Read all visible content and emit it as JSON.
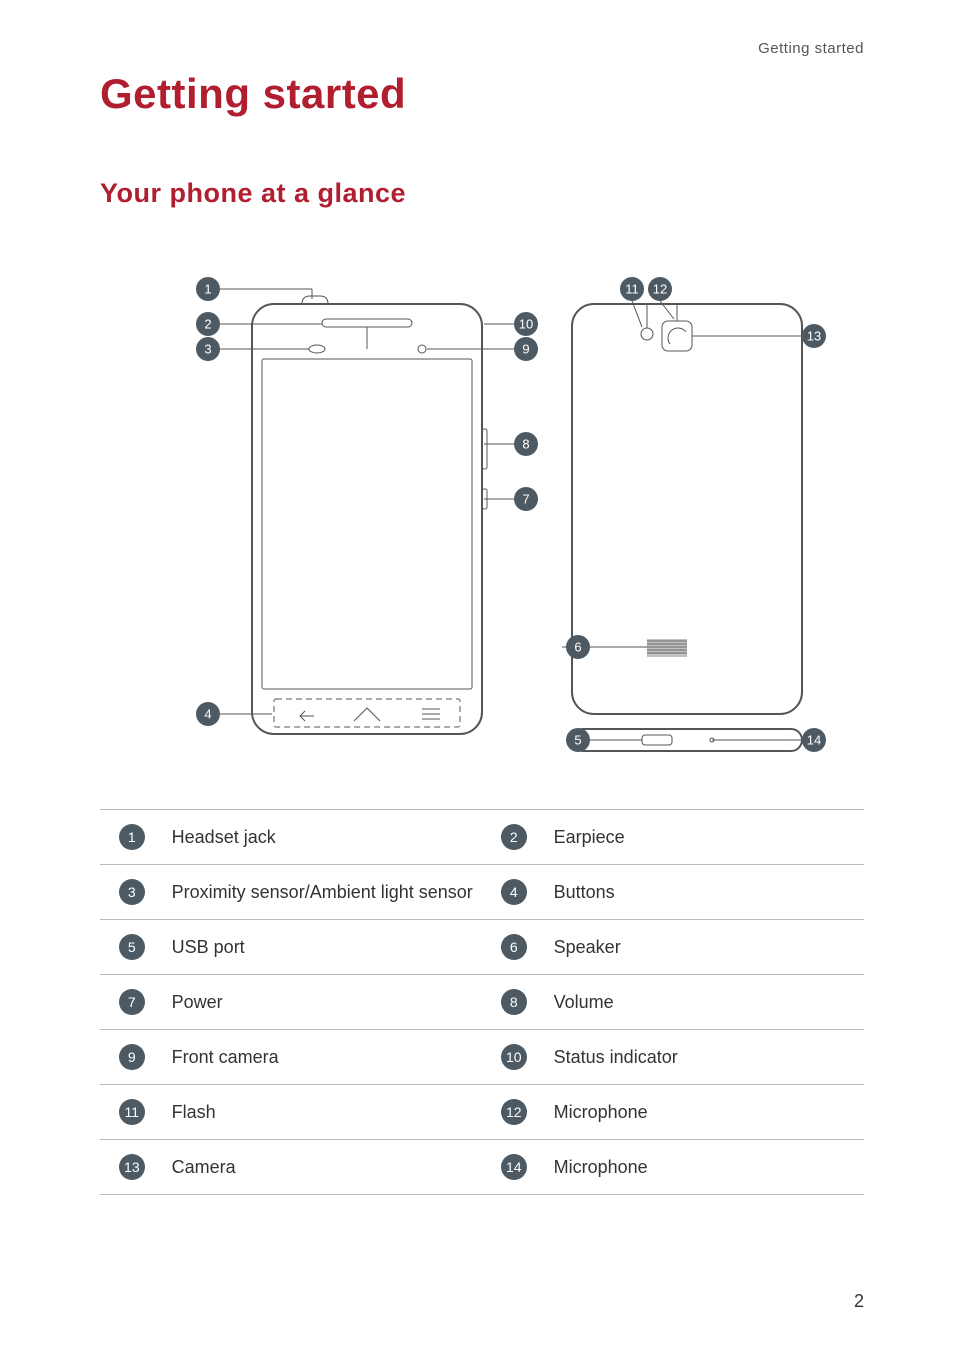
{
  "header": {
    "section": "Getting started"
  },
  "title": "Getting started",
  "subtitle": "Your phone at a glance",
  "parts": [
    {
      "num": "1",
      "label": "Headset jack",
      "num2": "2",
      "label2": "Earpiece"
    },
    {
      "num": "3",
      "label": "Proximity sensor/Ambient light sensor",
      "num2": "4",
      "label2": "Buttons"
    },
    {
      "num": "5",
      "label": "USB port",
      "num2": "6",
      "label2": "Speaker"
    },
    {
      "num": "7",
      "label": "Power",
      "num2": "8",
      "label2": "Volume"
    },
    {
      "num": "9",
      "label": "Front camera",
      "num2": "10",
      "label2": "Status indicator"
    },
    {
      "num": "11",
      "label": "Flash",
      "num2": "12",
      "label2": "Microphone"
    },
    {
      "num": "13",
      "label": "Camera",
      "num2": "14",
      "label2": "Microphone"
    }
  ],
  "diagram_callouts": [
    "1",
    "2",
    "3",
    "4",
    "5",
    "6",
    "7",
    "8",
    "9",
    "10",
    "11",
    "12",
    "13",
    "14"
  ],
  "page_number": "2",
  "chart_data": {
    "type": "table",
    "title": "Phone parts legend",
    "rows": [
      {
        "index": 1,
        "name": "Headset jack"
      },
      {
        "index": 2,
        "name": "Earpiece"
      },
      {
        "index": 3,
        "name": "Proximity sensor/Ambient light sensor"
      },
      {
        "index": 4,
        "name": "Buttons"
      },
      {
        "index": 5,
        "name": "USB port"
      },
      {
        "index": 6,
        "name": "Speaker"
      },
      {
        "index": 7,
        "name": "Power"
      },
      {
        "index": 8,
        "name": "Volume"
      },
      {
        "index": 9,
        "name": "Front camera"
      },
      {
        "index": 10,
        "name": "Status indicator"
      },
      {
        "index": 11,
        "name": "Flash"
      },
      {
        "index": 12,
        "name": "Microphone"
      },
      {
        "index": 13,
        "name": "Camera"
      },
      {
        "index": 14,
        "name": "Microphone"
      }
    ]
  }
}
